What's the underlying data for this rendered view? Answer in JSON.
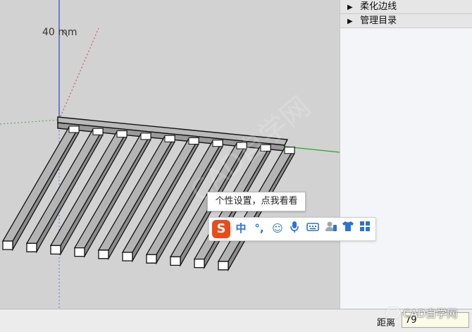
{
  "viewport": {
    "dimension_label": "40 mm",
    "watermark": "CAD自学网"
  },
  "tray": {
    "items": [
      {
        "label": "柔化边线",
        "icon": "triangle-right-icon"
      },
      {
        "label": "管理目录",
        "icon": "triangle-right-icon"
      }
    ]
  },
  "ime": {
    "tooltip": "个性设置，点我看看",
    "logo_letter": "S",
    "mode_label": "中",
    "punct_label": "°,",
    "buttons": [
      "emoji-icon",
      "microphone-icon",
      "keyboard-icon",
      "user-icon",
      "tshirt-icon",
      "grid-icon"
    ]
  },
  "status": {
    "measure_label": "距离",
    "measure_value": "79"
  },
  "brand": {
    "label": "CAD自学网"
  },
  "colors": {
    "axis_green": "#22aa22",
    "axis_blue": "#3344cc",
    "axis_red": "#cc3333",
    "ime_blue": "#2a73d6",
    "ime_logo": "#ea4b1b"
  }
}
